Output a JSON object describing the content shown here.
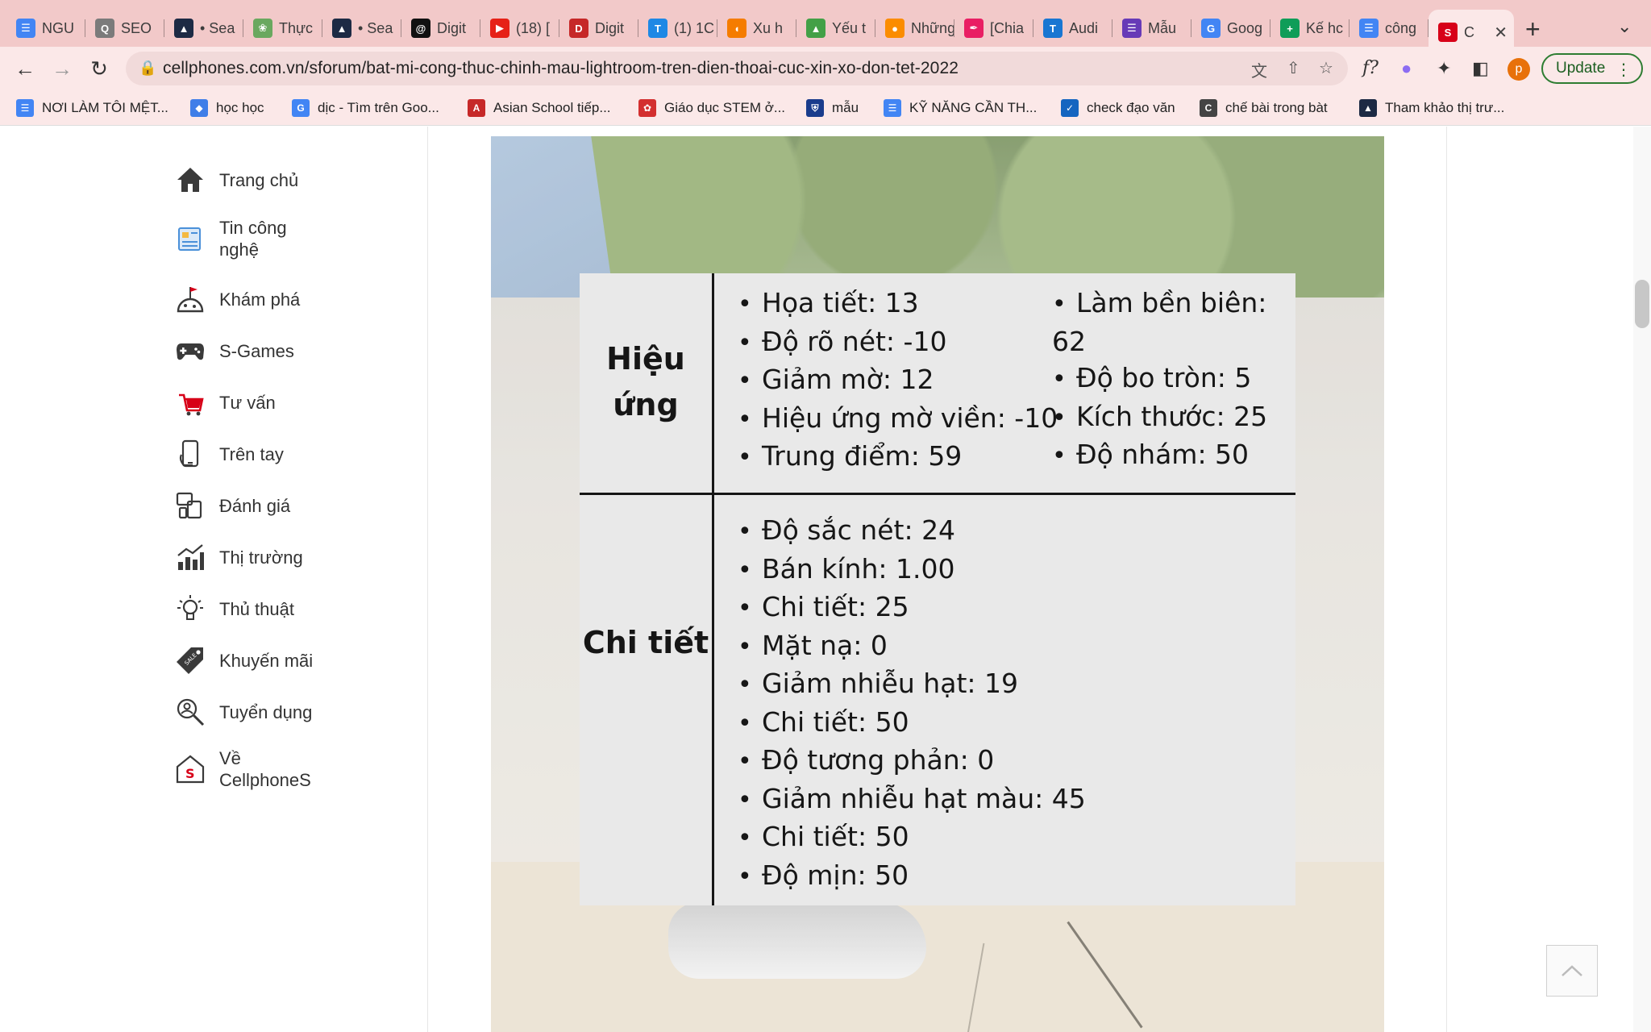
{
  "browser": {
    "tabs": [
      {
        "label": "NGU",
        "icon": "google-docs-icon",
        "color": "#4285f4"
      },
      {
        "label": "SEO",
        "icon": "seo-magnifier-icon",
        "color": "#7b7b7b"
      },
      {
        "label": "• Sea",
        "icon": "semrush-icon",
        "color": "#1d2a44"
      },
      {
        "label": "Thực",
        "icon": "leaf-icon",
        "color": "#6aa85f"
      },
      {
        "label": "• Sea",
        "icon": "semrush-icon",
        "color": "#1d2a44"
      },
      {
        "label": "Digit",
        "icon": "threads-icon",
        "color": "#111111"
      },
      {
        "label": "(18) [",
        "icon": "youtube-icon",
        "color": "#e62117"
      },
      {
        "label": "Digit",
        "icon": "digital-logo-icon",
        "color": "#c62828"
      },
      {
        "label": "(1) 1C",
        "icon": "t-blue-icon",
        "color": "#1e88e5"
      },
      {
        "label": "Xu h",
        "icon": "orange-swirl-icon",
        "color": "#f57c00"
      },
      {
        "label": "Yếu t",
        "icon": "mountain-icon",
        "color": "#43a047"
      },
      {
        "label": "Những",
        "icon": "candle-icon",
        "color": "#fb8c00"
      },
      {
        "label": "[Chia",
        "icon": "quill-icon",
        "color": "#e91e63"
      },
      {
        "label": "Audi",
        "icon": "t-letter-icon",
        "color": "#1976d2"
      },
      {
        "label": "Mẫu",
        "icon": "forms-icon",
        "color": "#673ab7"
      },
      {
        "label": "Goog",
        "icon": "google-icon",
        "color": "#4285f4"
      },
      {
        "label": "Kế hc",
        "icon": "sheets-plus-icon",
        "color": "#0f9d58"
      },
      {
        "label": "công",
        "icon": "google-docs-icon",
        "color": "#4285f4"
      },
      {
        "label": "C",
        "icon": "cellphones-icon",
        "color": "#d70018"
      }
    ],
    "url": "cellphones.com.vn/sforum/bat-mi-cong-thuc-chinh-mau-lightroom-tren-dien-thoai-cuc-xin-xo-don-tet-2022",
    "profile_initial": "p",
    "update_label": "Update",
    "bookmarks": [
      {
        "label": "NƠI LÀM TÔI MỆT...",
        "icon": "google-docs-icon",
        "color": "#4285f4"
      },
      {
        "label": "học học",
        "icon": "diamond-icon",
        "color": "#3f7ee8"
      },
      {
        "label": "dịc - Tìm trên Goo...",
        "icon": "google-icon",
        "color": "#4285f4"
      },
      {
        "label": "Asian School tiếp...",
        "icon": "asian-school-icon",
        "color": "#c62828"
      },
      {
        "label": "Giáo dục STEM ở...",
        "icon": "flower-icon",
        "color": "#d32f2f"
      },
      {
        "label": "mẫu",
        "icon": "shield-icon",
        "color": "#1a3c8c"
      },
      {
        "label": "KỸ NĂNG CẦN TH...",
        "icon": "google-docs-icon",
        "color": "#4285f4"
      },
      {
        "label": "check đạo văn",
        "icon": "check-circle-icon",
        "color": "#1565c0"
      },
      {
        "label": "chế bài trong bàt",
        "icon": "c-letter-icon",
        "color": "#444444"
      },
      {
        "label": "Tham khảo thị trư...",
        "icon": "semrush-icon",
        "color": "#1d2a44"
      }
    ]
  },
  "sidebar": {
    "items": [
      {
        "label": "Trang chủ",
        "icon": "home-icon"
      },
      {
        "label": "Tin công nghệ",
        "icon": "news-icon"
      },
      {
        "label": "Khám phá",
        "icon": "explore-planet-icon"
      },
      {
        "label": "S-Games",
        "icon": "gamepad-icon"
      },
      {
        "label": "Tư vấn",
        "icon": "cart-advice-icon"
      },
      {
        "label": "Trên tay",
        "icon": "hand-phone-icon"
      },
      {
        "label": "Đánh giá",
        "icon": "review-devices-icon"
      },
      {
        "label": "Thị trường",
        "icon": "market-chart-icon"
      },
      {
        "label": "Thủ thuật",
        "icon": "lightbulb-icon"
      },
      {
        "label": "Khuyến mãi",
        "icon": "sale-tag-icon"
      },
      {
        "label": "Tuyển dụng",
        "icon": "recruit-search-icon"
      },
      {
        "label": "Về CellphoneS",
        "icon": "cellphones-home-icon"
      }
    ]
  },
  "article_image": {
    "effects": {
      "heading": "Hiệu ứng",
      "left_items": [
        "Họa tiết: 13",
        "Độ rõ nét: -10",
        "Giảm mờ: 12",
        "Hiệu ứng mờ viền: -10",
        "Trung điểm: 59"
      ],
      "right_items": [
        "Làm bền biên: 62",
        "Độ bo tròn: 5",
        "Kích thước: 25",
        "Độ nhám: 50"
      ]
    },
    "details": {
      "heading": "Chi tiết",
      "items": [
        "Độ sắc nét: 24",
        "Bán kính: 1.00",
        "Chi tiết: 25",
        "Mặt nạ: 0",
        "Giảm nhiễu hạt: 19",
        "Chi tiết: 50",
        "Độ tương phản: 0",
        "Giảm nhiễu hạt màu: 45",
        "Chi tiết: 50",
        "Độ mịn: 50"
      ]
    }
  },
  "colors": {
    "tabstrip": "#f2c9c9",
    "toolbar": "#fbe8e8",
    "brand_red": "#d70018"
  }
}
